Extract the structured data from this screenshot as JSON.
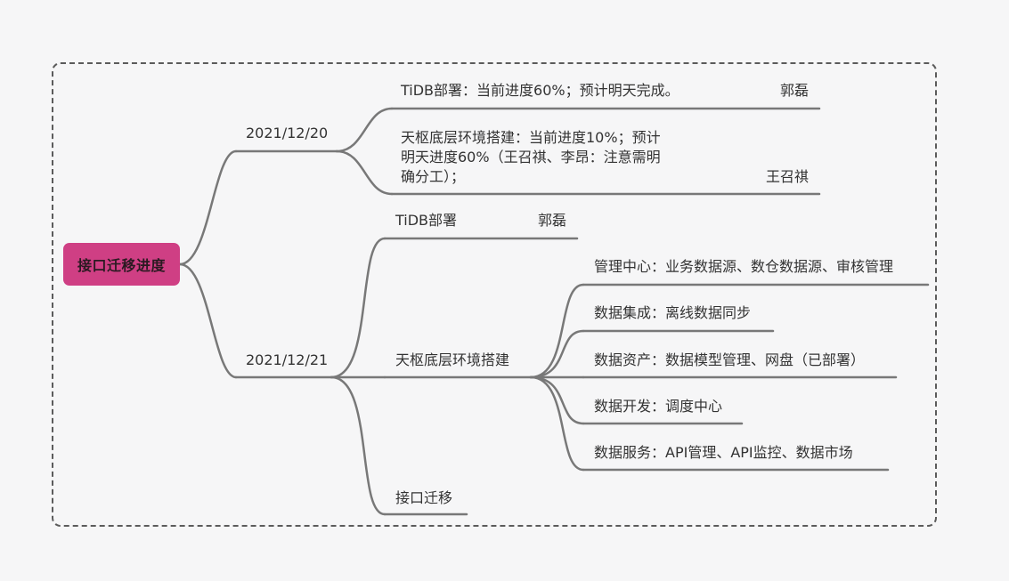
{
  "root": "接口迁移进度",
  "day1": {
    "date": "2021/12/20",
    "task1": {
      "text": "TiDB部署：当前进度60%；预计明天完成。",
      "owner": "郭磊"
    },
    "task2": {
      "line1": "天枢底层环境搭建：当前进度10%；预计",
      "line2": "明天进度60%（王召祺、李昂：注意需明",
      "line3": "确分工）；",
      "owner": "王召祺"
    }
  },
  "day2": {
    "date": "2021/12/21",
    "tidb": {
      "text": "TiDB部署",
      "owner": "郭磊"
    },
    "tianshu": {
      "text": "天枢底层环境搭建",
      "children": [
        "管理中心：业务数据源、数仓数据源、审核管理",
        "数据集成：离线数据同步",
        "数据资产：数据模型管理、网盘（已部署）",
        "数据开发：调度中心",
        "数据服务：API管理、API监控、数据市场"
      ]
    },
    "migrate": {
      "text": "接口迁移"
    }
  },
  "colors": {
    "background": "#f6f6f7",
    "root_fill": "#cf3f84",
    "line": "#787878",
    "frame": "#5b5b5b"
  }
}
